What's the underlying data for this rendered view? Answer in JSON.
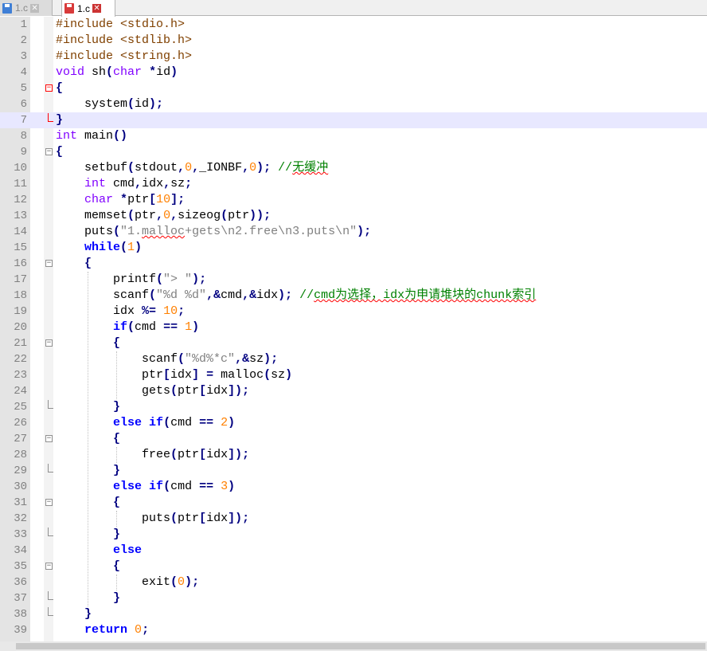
{
  "tabs": [
    {
      "label": "1.c",
      "icon": "save-icon-blue",
      "active": false
    },
    {
      "label": "1.c",
      "icon": "save-icon-red",
      "active": true
    }
  ],
  "editor": {
    "highlighted_line": 7,
    "lines": [
      {
        "n": "1",
        "tokens": [
          {
            "t": "pp",
            "s": "#include <stdio.h>"
          }
        ]
      },
      {
        "n": "2",
        "tokens": [
          {
            "t": "pp",
            "s": "#include <stdlib.h>"
          }
        ]
      },
      {
        "n": "3",
        "tokens": [
          {
            "t": "pp",
            "s": "#include <string.h>"
          }
        ]
      },
      {
        "n": "4",
        "tokens": [
          {
            "t": "ty",
            "s": "void"
          },
          {
            "t": "",
            "s": " sh"
          },
          {
            "t": "op",
            "s": "("
          },
          {
            "t": "ty",
            "s": "char"
          },
          {
            "t": "",
            "s": " "
          },
          {
            "t": "op",
            "s": "*"
          },
          {
            "t": "",
            "s": "id"
          },
          {
            "t": "op",
            "s": ")"
          }
        ]
      },
      {
        "n": "5",
        "tokens": [
          {
            "t": "op",
            "s": "{"
          }
        ]
      },
      {
        "n": "6",
        "tokens": [
          {
            "t": "",
            "s": "    system"
          },
          {
            "t": "op",
            "s": "("
          },
          {
            "t": "",
            "s": "id"
          },
          {
            "t": "op",
            "s": ");"
          }
        ]
      },
      {
        "n": "7",
        "tokens": [
          {
            "t": "op",
            "s": "}"
          }
        ]
      },
      {
        "n": "8",
        "tokens": [
          {
            "t": "ty",
            "s": "int"
          },
          {
            "t": "",
            "s": " main"
          },
          {
            "t": "op",
            "s": "()"
          }
        ]
      },
      {
        "n": "9",
        "tokens": [
          {
            "t": "op",
            "s": "{"
          }
        ]
      },
      {
        "n": "10",
        "tokens": [
          {
            "t": "",
            "s": "    setbuf"
          },
          {
            "t": "op",
            "s": "("
          },
          {
            "t": "",
            "s": "stdout"
          },
          {
            "t": "op",
            "s": ","
          },
          {
            "t": "num",
            "s": "0"
          },
          {
            "t": "op",
            "s": ","
          },
          {
            "t": "",
            "s": "_IONBF"
          },
          {
            "t": "op",
            "s": ","
          },
          {
            "t": "num",
            "s": "0"
          },
          {
            "t": "op",
            "s": ");"
          },
          {
            "t": "",
            "s": " "
          },
          {
            "t": "cm",
            "s": "//"
          },
          {
            "t": "cm sq",
            "s": "无缓冲"
          }
        ]
      },
      {
        "n": "11",
        "tokens": [
          {
            "t": "",
            "s": "    "
          },
          {
            "t": "ty",
            "s": "int"
          },
          {
            "t": "",
            "s": " cmd"
          },
          {
            "t": "op",
            "s": ","
          },
          {
            "t": "",
            "s": "idx"
          },
          {
            "t": "op",
            "s": ","
          },
          {
            "t": "",
            "s": "sz"
          },
          {
            "t": "op",
            "s": ";"
          }
        ]
      },
      {
        "n": "12",
        "tokens": [
          {
            "t": "",
            "s": "    "
          },
          {
            "t": "ty",
            "s": "char"
          },
          {
            "t": "",
            "s": " "
          },
          {
            "t": "op",
            "s": "*"
          },
          {
            "t": "",
            "s": "ptr"
          },
          {
            "t": "op",
            "s": "["
          },
          {
            "t": "num",
            "s": "10"
          },
          {
            "t": "op",
            "s": "];"
          }
        ]
      },
      {
        "n": "13",
        "tokens": [
          {
            "t": "",
            "s": "    memset"
          },
          {
            "t": "op",
            "s": "("
          },
          {
            "t": "",
            "s": "ptr"
          },
          {
            "t": "op",
            "s": ","
          },
          {
            "t": "num",
            "s": "0"
          },
          {
            "t": "op",
            "s": ","
          },
          {
            "t": "",
            "s": "sizeog"
          },
          {
            "t": "op",
            "s": "("
          },
          {
            "t": "",
            "s": "ptr"
          },
          {
            "t": "op",
            "s": "));"
          }
        ]
      },
      {
        "n": "14",
        "tokens": [
          {
            "t": "",
            "s": "    puts"
          },
          {
            "t": "op",
            "s": "("
          },
          {
            "t": "str",
            "s": "\"1."
          },
          {
            "t": "str sq",
            "s": "malloc"
          },
          {
            "t": "str",
            "s": "+gets\\n2.free\\n3.puts\\n\""
          },
          {
            "t": "op",
            "s": ");"
          }
        ]
      },
      {
        "n": "15",
        "tokens": [
          {
            "t": "",
            "s": "    "
          },
          {
            "t": "kw",
            "s": "while"
          },
          {
            "t": "op",
            "s": "("
          },
          {
            "t": "num",
            "s": "1"
          },
          {
            "t": "op",
            "s": ")"
          }
        ]
      },
      {
        "n": "16",
        "tokens": [
          {
            "t": "",
            "s": "    "
          },
          {
            "t": "op",
            "s": "{"
          }
        ]
      },
      {
        "n": "17",
        "tokens": [
          {
            "t": "",
            "s": "        printf"
          },
          {
            "t": "op",
            "s": "("
          },
          {
            "t": "str",
            "s": "\"> \""
          },
          {
            "t": "op",
            "s": ");"
          }
        ]
      },
      {
        "n": "18",
        "tokens": [
          {
            "t": "",
            "s": "        scanf"
          },
          {
            "t": "op",
            "s": "("
          },
          {
            "t": "str",
            "s": "\"%d %d\""
          },
          {
            "t": "op",
            "s": ",&"
          },
          {
            "t": "",
            "s": "cmd"
          },
          {
            "t": "op",
            "s": ",&"
          },
          {
            "t": "",
            "s": "idx"
          },
          {
            "t": "op",
            "s": ");"
          },
          {
            "t": "",
            "s": " "
          },
          {
            "t": "cm",
            "s": "//"
          },
          {
            "t": "cm sq",
            "s": "cmd为选择，idx为申请堆块的chunk索引"
          }
        ]
      },
      {
        "n": "19",
        "tokens": [
          {
            "t": "",
            "s": "        idx "
          },
          {
            "t": "op",
            "s": "%="
          },
          {
            "t": "",
            "s": " "
          },
          {
            "t": "num",
            "s": "10"
          },
          {
            "t": "op",
            "s": ";"
          }
        ]
      },
      {
        "n": "20",
        "tokens": [
          {
            "t": "",
            "s": "        "
          },
          {
            "t": "kw",
            "s": "if"
          },
          {
            "t": "op",
            "s": "("
          },
          {
            "t": "",
            "s": "cmd "
          },
          {
            "t": "op",
            "s": "=="
          },
          {
            "t": "",
            "s": " "
          },
          {
            "t": "num",
            "s": "1"
          },
          {
            "t": "op",
            "s": ")"
          }
        ]
      },
      {
        "n": "21",
        "tokens": [
          {
            "t": "",
            "s": "        "
          },
          {
            "t": "op",
            "s": "{"
          }
        ]
      },
      {
        "n": "22",
        "tokens": [
          {
            "t": "",
            "s": "            scanf"
          },
          {
            "t": "op",
            "s": "("
          },
          {
            "t": "str",
            "s": "\"%d%*c\""
          },
          {
            "t": "op",
            "s": ",&"
          },
          {
            "t": "",
            "s": "sz"
          },
          {
            "t": "op",
            "s": ");"
          }
        ]
      },
      {
        "n": "23",
        "tokens": [
          {
            "t": "",
            "s": "            ptr"
          },
          {
            "t": "op",
            "s": "["
          },
          {
            "t": "",
            "s": "idx"
          },
          {
            "t": "op",
            "s": "]"
          },
          {
            "t": "",
            "s": " "
          },
          {
            "t": "op",
            "s": "="
          },
          {
            "t": "",
            "s": " malloc"
          },
          {
            "t": "op",
            "s": "("
          },
          {
            "t": "",
            "s": "sz"
          },
          {
            "t": "op",
            "s": ")"
          }
        ]
      },
      {
        "n": "24",
        "tokens": [
          {
            "t": "",
            "s": "            gets"
          },
          {
            "t": "op",
            "s": "("
          },
          {
            "t": "",
            "s": "ptr"
          },
          {
            "t": "op",
            "s": "["
          },
          {
            "t": "",
            "s": "idx"
          },
          {
            "t": "op",
            "s": "]);"
          }
        ]
      },
      {
        "n": "25",
        "tokens": [
          {
            "t": "",
            "s": "        "
          },
          {
            "t": "op",
            "s": "}"
          }
        ]
      },
      {
        "n": "26",
        "tokens": [
          {
            "t": "",
            "s": "        "
          },
          {
            "t": "kw",
            "s": "else"
          },
          {
            "t": "",
            "s": " "
          },
          {
            "t": "kw",
            "s": "if"
          },
          {
            "t": "op",
            "s": "("
          },
          {
            "t": "",
            "s": "cmd "
          },
          {
            "t": "op",
            "s": "=="
          },
          {
            "t": "",
            "s": " "
          },
          {
            "t": "num",
            "s": "2"
          },
          {
            "t": "op",
            "s": ")"
          }
        ]
      },
      {
        "n": "27",
        "tokens": [
          {
            "t": "",
            "s": "        "
          },
          {
            "t": "op",
            "s": "{"
          }
        ]
      },
      {
        "n": "28",
        "tokens": [
          {
            "t": "",
            "s": "            free"
          },
          {
            "t": "op",
            "s": "("
          },
          {
            "t": "",
            "s": "ptr"
          },
          {
            "t": "op",
            "s": "["
          },
          {
            "t": "",
            "s": "idx"
          },
          {
            "t": "op",
            "s": "]);"
          }
        ]
      },
      {
        "n": "29",
        "tokens": [
          {
            "t": "",
            "s": "        "
          },
          {
            "t": "op",
            "s": "}"
          }
        ]
      },
      {
        "n": "30",
        "tokens": [
          {
            "t": "",
            "s": "        "
          },
          {
            "t": "kw",
            "s": "else"
          },
          {
            "t": "",
            "s": " "
          },
          {
            "t": "kw",
            "s": "if"
          },
          {
            "t": "op",
            "s": "("
          },
          {
            "t": "",
            "s": "cmd "
          },
          {
            "t": "op",
            "s": "=="
          },
          {
            "t": "",
            "s": " "
          },
          {
            "t": "num",
            "s": "3"
          },
          {
            "t": "op",
            "s": ")"
          }
        ]
      },
      {
        "n": "31",
        "tokens": [
          {
            "t": "",
            "s": "        "
          },
          {
            "t": "op",
            "s": "{"
          }
        ]
      },
      {
        "n": "32",
        "tokens": [
          {
            "t": "",
            "s": "            puts"
          },
          {
            "t": "op",
            "s": "("
          },
          {
            "t": "",
            "s": "ptr"
          },
          {
            "t": "op",
            "s": "["
          },
          {
            "t": "",
            "s": "idx"
          },
          {
            "t": "op",
            "s": "]);"
          }
        ]
      },
      {
        "n": "33",
        "tokens": [
          {
            "t": "",
            "s": "        "
          },
          {
            "t": "op",
            "s": "}"
          }
        ]
      },
      {
        "n": "34",
        "tokens": [
          {
            "t": "",
            "s": "        "
          },
          {
            "t": "kw",
            "s": "else"
          }
        ]
      },
      {
        "n": "35",
        "tokens": [
          {
            "t": "",
            "s": "        "
          },
          {
            "t": "op",
            "s": "{"
          }
        ]
      },
      {
        "n": "36",
        "tokens": [
          {
            "t": "",
            "s": "            exit"
          },
          {
            "t": "op",
            "s": "("
          },
          {
            "t": "num",
            "s": "0"
          },
          {
            "t": "op",
            "s": ");"
          }
        ]
      },
      {
        "n": "37",
        "tokens": [
          {
            "t": "",
            "s": "        "
          },
          {
            "t": "op",
            "s": "}"
          }
        ]
      },
      {
        "n": "38",
        "tokens": [
          {
            "t": "",
            "s": "    "
          },
          {
            "t": "op",
            "s": "}"
          }
        ]
      },
      {
        "n": "39",
        "tokens": [
          {
            "t": "",
            "s": "    "
          },
          {
            "t": "kw",
            "s": "return"
          },
          {
            "t": "",
            "s": " "
          },
          {
            "t": "num",
            "s": "0"
          },
          {
            "t": "op",
            "s": ";"
          }
        ]
      }
    ],
    "fold_markers": [
      {
        "line": 5,
        "type": "open",
        "color": "red"
      },
      {
        "line": 7,
        "type": "end",
        "color": "red"
      },
      {
        "line": 9,
        "type": "open"
      },
      {
        "line": 16,
        "type": "open"
      },
      {
        "line": 21,
        "type": "open"
      },
      {
        "line": 25,
        "type": "end"
      },
      {
        "line": 27,
        "type": "open"
      },
      {
        "line": 29,
        "type": "end"
      },
      {
        "line": 31,
        "type": "open"
      },
      {
        "line": 33,
        "type": "end"
      },
      {
        "line": 35,
        "type": "open"
      },
      {
        "line": 37,
        "type": "end"
      },
      {
        "line": 38,
        "type": "end"
      }
    ]
  },
  "colors": {
    "keyword": "#0000ff",
    "type": "#8000ff",
    "preprocessor": "#804000",
    "number": "#ff8000",
    "string": "#808080",
    "operator": "#000080",
    "comment": "#008000",
    "current_line": "#e8e8ff"
  }
}
